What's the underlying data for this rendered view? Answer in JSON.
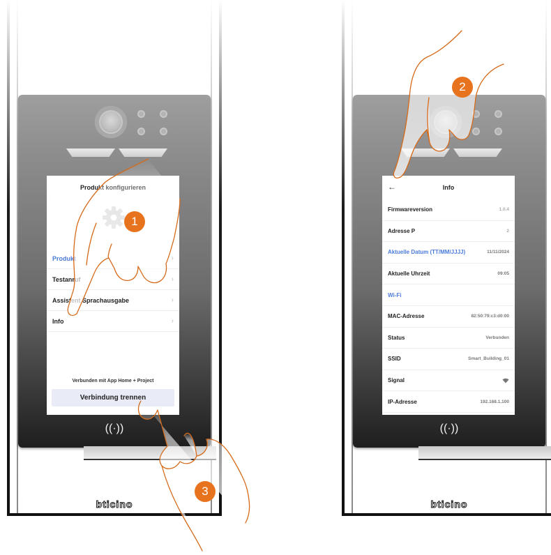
{
  "left_panel": {
    "screen_title": "Produkt konfigurieren",
    "menu": [
      {
        "label": "Produkt",
        "highlighted": true
      },
      {
        "label": "Testanruf",
        "highlighted": false
      },
      {
        "label": "Assistent Sprachausgabe",
        "highlighted": false
      },
      {
        "label": "Info",
        "highlighted": false
      }
    ],
    "connected_text": "Verbunden mit App Home + Project",
    "disconnect_label": "Verbindung trennen",
    "nfc_symbol": "((·))",
    "brand": "bticino"
  },
  "right_panel": {
    "screen_title": "Info",
    "back_icon": "←",
    "rows": [
      {
        "label": "Firmwareversion",
        "value": "1.0.4"
      },
      {
        "label": "Adresse P",
        "value": "2"
      },
      {
        "label": "Aktuelle Datum (TT/MM/JJJJ)",
        "value": "11/11/2024"
      },
      {
        "label": "Aktuelle Uhrzeit",
        "value": "09:05"
      },
      {
        "label": "Wi-Fi",
        "value": ""
      },
      {
        "label": "MAC-Adresse",
        "value": "82:50:79:c3:d0:00"
      },
      {
        "label": "Status",
        "value": "Verbunden"
      },
      {
        "label": "SSID",
        "value": "Smart_Building_01"
      },
      {
        "label": "Signal",
        "value": ""
      },
      {
        "label": "IP-Adresse",
        "value": "192.168.1.100"
      }
    ],
    "nfc_symbol": "((·))",
    "brand": "bticino"
  },
  "badges": [
    "1",
    "2",
    "3"
  ],
  "colors": {
    "accent_blue": "#4b7bd9",
    "badge_orange": "#e8731e",
    "hand_outline": "#d56a1a"
  }
}
